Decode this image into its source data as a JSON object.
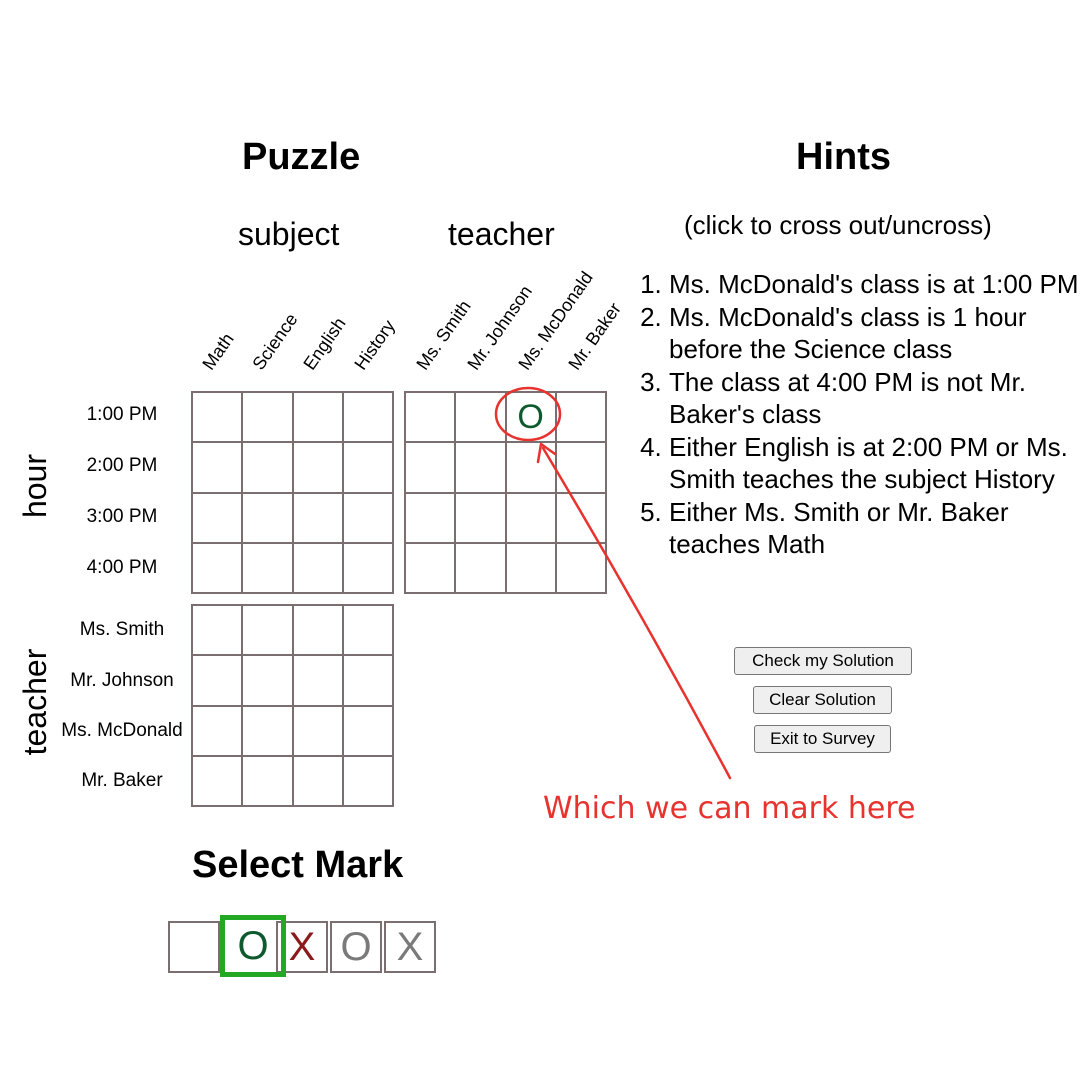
{
  "puzzle": {
    "title": "Puzzle",
    "group_labels": {
      "subject": "subject",
      "teacher": "teacher"
    },
    "side_labels": {
      "hour": "hour",
      "teacher": "teacher"
    },
    "subject_columns": [
      "Math",
      "Science",
      "English",
      "History"
    ],
    "teacher_columns": [
      "Ms. Smith",
      "Mr. Johnson",
      "Ms. McDonald",
      "Mr. Baker"
    ],
    "hour_rows": [
      "1:00 PM",
      "2:00 PM",
      "3:00 PM",
      "4:00 PM"
    ],
    "teacher_rows": [
      "Ms. Smith",
      "Mr. Johnson",
      "Ms. McDonald",
      "Mr. Baker"
    ],
    "grids": {
      "hour_subject": [
        [
          "",
          "",
          "",
          ""
        ],
        [
          "",
          "",
          "",
          ""
        ],
        [
          "",
          "",
          "",
          ""
        ],
        [
          "",
          "",
          "",
          ""
        ]
      ],
      "hour_teacher": [
        [
          "",
          "",
          "O",
          ""
        ],
        [
          "",
          "",
          "",
          ""
        ],
        [
          "",
          "",
          "",
          ""
        ],
        [
          "",
          "",
          "",
          ""
        ]
      ],
      "teacher_subject": [
        [
          "",
          "",
          "",
          ""
        ],
        [
          "",
          "",
          "",
          ""
        ],
        [
          "",
          "",
          "",
          ""
        ],
        [
          "",
          "",
          "",
          ""
        ]
      ]
    }
  },
  "hints": {
    "title": "Hints",
    "subtitle": "(click to cross out/uncross)",
    "items": [
      "Ms. McDonald's class is at 1:00 PM",
      "Ms. McDonald's class is 1 hour before the Science class",
      "The class at 4:00 PM is not Mr. Baker's class",
      "Either English is at 2:00 PM or Ms. Smith teaches the subject History",
      "Either Ms. Smith or Mr. Baker teaches Math"
    ]
  },
  "buttons": {
    "check": "Check my Solution",
    "clear": "Clear Solution",
    "exit": "Exit to Survey"
  },
  "select_mark": {
    "title": "Select Mark",
    "options": [
      {
        "symbol": "",
        "color": "#000000",
        "selected": false
      },
      {
        "symbol": "O",
        "color": "#0e5a2e",
        "selected": true
      },
      {
        "symbol": "X",
        "color": "#8b1a1a",
        "selected": false
      },
      {
        "symbol": "O",
        "color": "#7a7a7a",
        "selected": false
      },
      {
        "symbol": "X",
        "color": "#7a7a7a",
        "selected": false
      }
    ],
    "selected_border_color": "#22a822"
  },
  "annotation": {
    "text": "Which we can mark here",
    "color": "#e8322e"
  }
}
